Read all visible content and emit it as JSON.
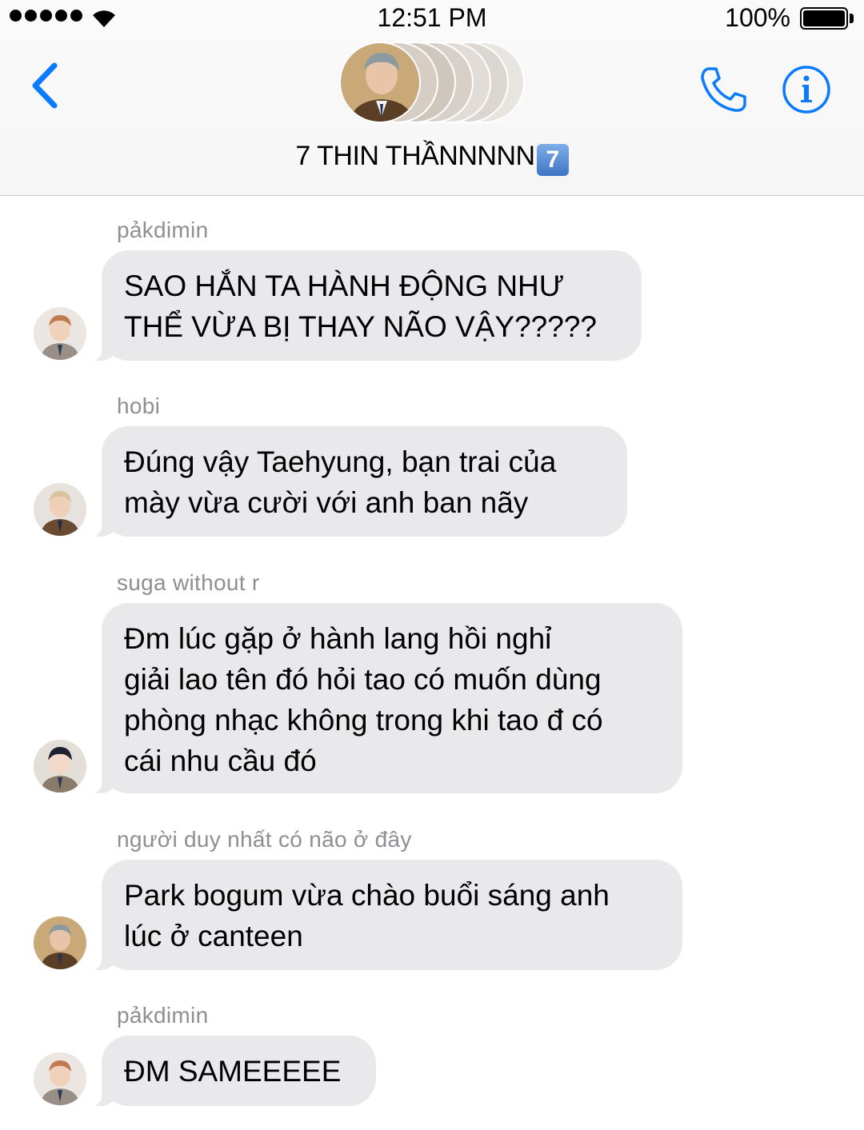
{
  "status_bar": {
    "time": "12:51 PM",
    "battery": "100%",
    "signal_icon": "signal-dots-icon",
    "wifi_icon": "wifi-icon",
    "battery_icon": "battery-full-icon"
  },
  "header": {
    "title": "7 THIN THẦNNNNN",
    "title_emoji": "7",
    "back_icon": "chevron-left-icon",
    "call_icon": "phone-icon",
    "info_icon": "info-icon"
  },
  "colors": {
    "accent": "#0a7aff",
    "bubble": "#e9e9eb",
    "sender": "#8e8e93"
  },
  "messages": [
    {
      "sender": "pảkdimin",
      "text": "SAO HẮN TA HÀNH ĐỘNG NHƯ\nTHỂ VỪA BỊ THAY NÃO VẬY?????"
    },
    {
      "sender": "hobi",
      "text": "Đúng vậy Taehyung, bạn trai của\nmày vừa cười với anh ban nãy"
    },
    {
      "sender": "suga without r",
      "text": "Đm lúc gặp ở hành lang hồi nghỉ\ngiải lao tên đó hỏi tao có muốn dùng\nphòng nhạc không trong khi tao đ có\ncái nhu cầu đó"
    },
    {
      "sender": "người duy nhất có não ở đây",
      "text": "Park bogum vừa chào buổi sáng anh\nlúc ở canteen"
    },
    {
      "sender": "pảkdimin",
      "text": "ĐM SAMEEEEE"
    }
  ]
}
